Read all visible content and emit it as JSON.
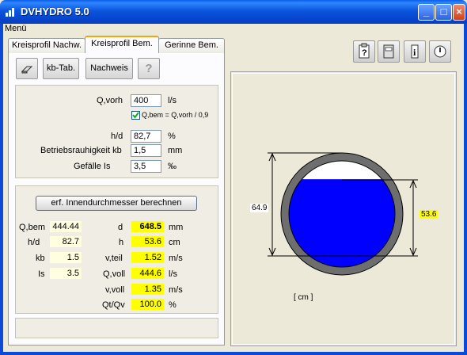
{
  "window": {
    "title": "DVHYDRO 5.0"
  },
  "menu": {
    "label": "Menü"
  },
  "tabs": [
    "Kreisprofil Nachw.",
    "Kreisprofil Bem.",
    "Gerinne Bem."
  ],
  "toolbar": {
    "kbtab": "kb-Tab.",
    "nachweis": "Nachweis",
    "help": "?"
  },
  "input": {
    "qvorh_label": "Q,vorh",
    "qvorh_value": "400",
    "qvorh_unit": "l/s",
    "checkbox_label": "Q,bem = Q,vorh / 0,9",
    "checkbox_checked": true,
    "hd_label": "h/d",
    "hd_value": "82,7",
    "hd_unit": "%",
    "kb_label": "Betriebsrauhigkeit  kb",
    "kb_value": "1,5",
    "kb_unit": "mm",
    "ls_label": "Gefälle  Is",
    "ls_value": "3,5",
    "ls_unit": "‰"
  },
  "results": {
    "calc_button": "erf. Innendurchmesser berechnen",
    "left": [
      {
        "label": "Q,bem",
        "value": "444.44"
      },
      {
        "label": "h/d",
        "value": "82.7"
      },
      {
        "label": "kb",
        "value": "1.5"
      },
      {
        "label": "Is",
        "value": "3.5"
      }
    ],
    "right": [
      {
        "label": "d",
        "value": "648.5",
        "unit": "mm"
      },
      {
        "label": "h",
        "value": "53.6",
        "unit": "cm"
      },
      {
        "label": "v,teil",
        "value": "1.52",
        "unit": "m/s"
      },
      {
        "label": "Q,voll",
        "value": "444.6",
        "unit": "l/s"
      },
      {
        "label": "v,voll",
        "value": "1.35",
        "unit": "m/s"
      },
      {
        "label": "Qt/Qv",
        "value": "100.0",
        "unit": "%"
      }
    ]
  },
  "drawing": {
    "diameter_label": "64.9",
    "height_label": "53.6",
    "unit_label": "[ cm ]",
    "fill_ratio": 0.827
  },
  "colors": {
    "water": "#0000ff",
    "pipe": "#6e6e6e",
    "highlight": "#ffff00",
    "pale": "#ffffe0"
  }
}
